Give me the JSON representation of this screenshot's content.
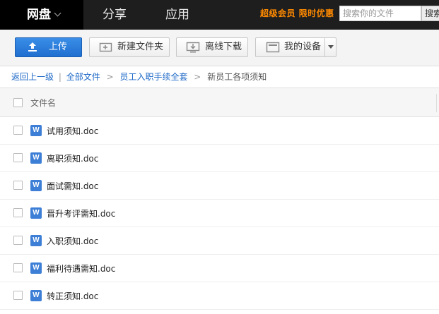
{
  "nav": {
    "tabs": [
      {
        "label": "网盘",
        "active": true
      },
      {
        "label": "分享",
        "active": false
      },
      {
        "label": "应用",
        "active": false
      }
    ],
    "promo": "超级会员 限时优惠",
    "search_placeholder": "搜索你的文件",
    "search_button": "搜索"
  },
  "toolbar": {
    "upload": "上传",
    "new_folder": "新建文件夹",
    "offline_download": "离线下载",
    "my_devices": "我的设备"
  },
  "breadcrumb": {
    "back": "返回上一级",
    "divider": "|",
    "all_files": "全部文件",
    "folder": "员工入职手续全套",
    "current": "新员工各项须知",
    "sep": ">"
  },
  "list": {
    "header": "文件名",
    "file_icon_letter": "W",
    "files": [
      {
        "name": "试用须知.doc"
      },
      {
        "name": "离职须知.doc"
      },
      {
        "name": "面试需知.doc"
      },
      {
        "name": "晋升考评需知.doc"
      },
      {
        "name": "入职须知.doc"
      },
      {
        "name": "福利待遇需知.doc"
      },
      {
        "name": "转正须知.doc"
      }
    ]
  },
  "colors": {
    "nav_bg": "#1e1e1e",
    "promo": "#ff8a00",
    "primary_button": "#1f6fd0",
    "link": "#1a66c7",
    "word_icon": "#3d7fd6"
  }
}
